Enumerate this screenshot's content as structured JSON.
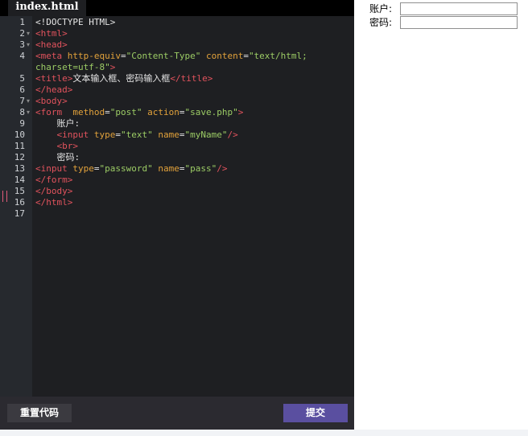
{
  "editor": {
    "tab_label": "index.html",
    "line_numbers": [
      "1",
      "2",
      "3",
      "4",
      "5",
      "6",
      "7",
      "8",
      "9",
      "10",
      "11",
      "12",
      "13",
      "14",
      "15",
      "16",
      "17"
    ],
    "fold_marker": "▾",
    "lines": {
      "l1": {
        "p1": "<!DOCTYPE HTML>"
      },
      "l2": {
        "t1": "<html>"
      },
      "l3": {
        "t1": "<head>"
      },
      "l4a": {
        "t1": "<meta ",
        "a1": "http-equiv",
        "p1": "=",
        "s1": "\"Content-Type\"",
        "p2": " ",
        "a2": "content",
        "p3": "=",
        "s2": "\"text/html;"
      },
      "l4b": {
        "s1": "charset=utf-8\"",
        "t1": ">"
      },
      "l5": {
        "t1": "<title>",
        "p1": "文本输入框、密码输入框",
        "t2": "</title>"
      },
      "l6": {
        "t1": "</head>"
      },
      "l7": {
        "t1": "<body>"
      },
      "l8": {
        "t1": "<form  ",
        "a1": "method",
        "p1": "=",
        "s1": "\"post\"",
        "p2": " ",
        "a2": "action",
        "p3": "=",
        "s2": "\"save.php\"",
        "t2": ">"
      },
      "l9": {
        "p1": "    账户:"
      },
      "l10": {
        "p0": "    ",
        "t1": "<input ",
        "a1": "type",
        "p1": "=",
        "s1": "\"text\"",
        "p2": " ",
        "a2": "name",
        "p3": "=",
        "s2": "\"myName\"",
        "t2": "/>"
      },
      "l11": {
        "p0": "    ",
        "t1": "<br>"
      },
      "l12": {
        "p1": "    密码:"
      },
      "l13": {
        "t1": "<input ",
        "a1": "type",
        "p1": "=",
        "s1": "\"password\"",
        "p2": " ",
        "a2": "name",
        "p3": "=",
        "s2": "\"pass\"",
        "t2": "/>"
      },
      "l14": {
        "t1": "</form>"
      },
      "l15": {
        "t1": "</body>"
      },
      "l16": {
        "t1": "</html>"
      }
    },
    "reset_button_label": "重置代码",
    "submit_button_label": "提交"
  },
  "preview": {
    "account_label": "账户:",
    "password_label": "密码:",
    "account_value": "",
    "password_value": ""
  },
  "colors": {
    "tag": "#e2535d",
    "attribute": "#e2a23b",
    "string": "#9ccc65",
    "plain": "#e6e6e6",
    "submit_accent": "#5a4fa0"
  }
}
